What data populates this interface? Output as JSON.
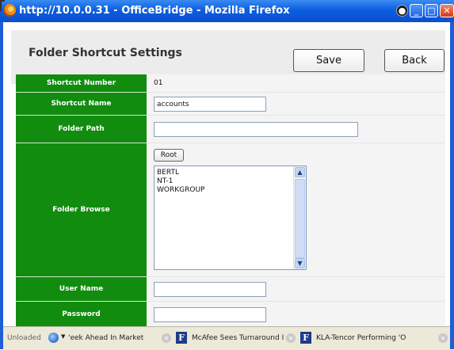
{
  "window": {
    "title": "http://10.0.0.31 - OfficeBridge - Mozilla Firefox",
    "controls": {
      "extra": "●",
      "minimize": "_",
      "maximize": "□",
      "close": "✕"
    }
  },
  "header": {
    "title": "Folder Shortcut Settings",
    "save_label": "Save",
    "back_label": "Back"
  },
  "form": {
    "shortcut_number": {
      "label": "Shortcut Number",
      "value": "01"
    },
    "shortcut_name": {
      "label": "Shortcut Name",
      "value": "accounts"
    },
    "folder_path": {
      "label": "Folder Path",
      "value": ""
    },
    "folder_browse": {
      "label": "Folder Browse",
      "root_label": "Root",
      "items": [
        "BERTL",
        "NT-1",
        "WORKGROUP"
      ]
    },
    "user_name": {
      "label": "User Name",
      "value": ""
    },
    "password": {
      "label": "Password",
      "value": ""
    }
  },
  "statusbar": {
    "status": "Unloaded",
    "tickers": [
      "Week Ahead In Market",
      "McAfee Sees Turnaround I",
      "KLA-Tencor Performing 'O"
    ],
    "ticker_visible": [
      "'eek Ahead In Market",
      "McAfee Sees Turnaround I",
      "KLA-Tencor Performing 'O"
    ],
    "f_icon": "F"
  },
  "colors": {
    "label_bg": "#118c0f",
    "titlebar": "#0c5ee0",
    "value_bg": "#f4f4f4"
  }
}
